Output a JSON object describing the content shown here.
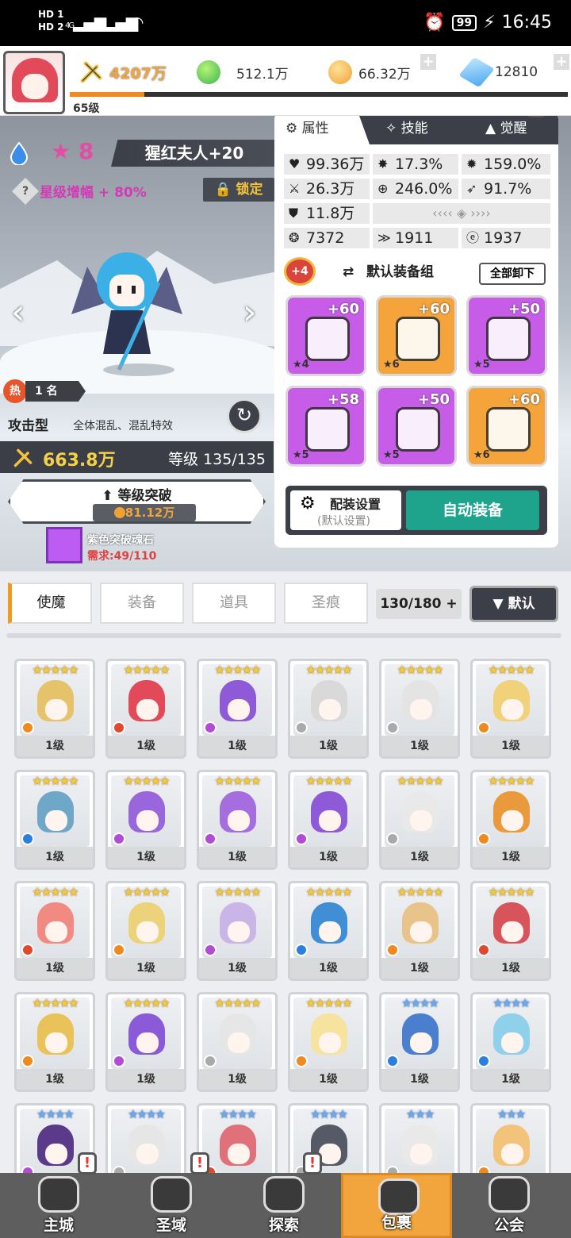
{
  "status_bar": {
    "hd1": "HD 1",
    "hd2": "HD 2",
    "net1": "4G",
    "net2": "4G",
    "battery": "99",
    "time": "16:45"
  },
  "topbar": {
    "level": "65级",
    "xp_fraction": 0.15,
    "power": "4207万",
    "gems_green": "512.1万",
    "gold": "66.32万",
    "crystals": "12810"
  },
  "hero": {
    "star_count": "8",
    "name": "猩红夫人+20",
    "star_boost": "星级增幅 + 80%",
    "lock_label": "锁定",
    "hot_label": "热",
    "rank": "1 名",
    "type": "攻击型",
    "skill_desc": "全体混乱、混乱特效",
    "power": "663.8万",
    "level": "等级 135/135",
    "break_label": "等级突破",
    "break_cost": "81.12万",
    "material_name": "紫色突破魂石",
    "material_req": "需求:49/110"
  },
  "attr_panel": {
    "tabs": [
      "属性",
      "技能",
      "觉醒"
    ],
    "stats": {
      "hp": "99.36万",
      "crit": "17.3%",
      "crit_dmg": "159.0%",
      "atk": "26.3万",
      "hit": "246.0%",
      "speed": "91.7%",
      "def": "11.8万",
      "s1": "7372",
      "s2": "1911",
      "s3": "1937"
    },
    "set_badge": "+4",
    "set_name": "默认装备组",
    "unload_all": "全部卸下",
    "equipment": [
      {
        "plus": "+60",
        "stars": "★4",
        "rarity": "purple"
      },
      {
        "plus": "+60",
        "stars": "★6",
        "rarity": "orange"
      },
      {
        "plus": "+50",
        "stars": "★5",
        "rarity": "purple"
      },
      {
        "plus": "+58",
        "stars": "★5",
        "rarity": "purple"
      },
      {
        "plus": "+50",
        "stars": "★5",
        "rarity": "purple"
      },
      {
        "plus": "+60",
        "stars": "★6",
        "rarity": "orange"
      }
    ],
    "config_label": "配装设置",
    "config_sub": "(默认设置)",
    "auto_equip": "自动装备"
  },
  "inventory": {
    "tabs": [
      "使魔",
      "装备",
      "道具",
      "圣痕"
    ],
    "count": "130/180",
    "sort_label": "▼ 默认"
  },
  "heroes": [
    {
      "stars": "★★★★★",
      "tier": "gold",
      "lv": "1级",
      "hair": "#e6c36a",
      "el": "#f08a1e"
    },
    {
      "stars": "★★★★★",
      "tier": "gold",
      "lv": "1级",
      "hair": "#e24a5a",
      "el": "#e0492b"
    },
    {
      "stars": "★★★★★",
      "tier": "gold",
      "lv": "1级",
      "hair": "#8e5ad8",
      "el": "#b24bd6"
    },
    {
      "stars": "★★★★★",
      "tier": "gold",
      "lv": "1级",
      "hair": "#d9d9d9",
      "el": "#aaaaaa"
    },
    {
      "stars": "★★★★★",
      "tier": "gold",
      "lv": "1级",
      "hair": "#e4e4e4",
      "el": "#aaaaaa"
    },
    {
      "stars": "★★★★★",
      "tier": "gold",
      "lv": "1级",
      "hair": "#f1d27a",
      "el": "#f08a1e"
    },
    {
      "stars": "★★★★★",
      "tier": "gold",
      "lv": "1级",
      "hair": "#6fa7c9",
      "el": "#2a7fe0"
    },
    {
      "stars": "★★★★★",
      "tier": "gold",
      "lv": "1级",
      "hair": "#9a66dc",
      "el": "#b24bd6"
    },
    {
      "stars": "★★★★★",
      "tier": "gold",
      "lv": "1级",
      "hair": "#a66ddf",
      "el": "#b24bd6"
    },
    {
      "stars": "★★★★★",
      "tier": "gold",
      "lv": "1级",
      "hair": "#8e5ad8",
      "el": "#b24bd6"
    },
    {
      "stars": "★★★★★",
      "tier": "gold",
      "lv": "1级",
      "hair": "#e9e9e9",
      "el": "#aaaaaa"
    },
    {
      "stars": "★★★★★",
      "tier": "gold",
      "lv": "1级",
      "hair": "#e99a3d",
      "el": "#f08a1e"
    },
    {
      "stars": "★★★★★",
      "tier": "gold",
      "lv": "1级",
      "hair": "#f08a82",
      "el": "#e0492b"
    },
    {
      "stars": "★★★★★",
      "tier": "gold",
      "lv": "1级",
      "hair": "#ecd27a",
      "el": "#f08a1e"
    },
    {
      "stars": "★★★★★",
      "tier": "gold",
      "lv": "1级",
      "hair": "#c9b6e6",
      "el": "#b24bd6"
    },
    {
      "stars": "★★★★★",
      "tier": "gold",
      "lv": "1级",
      "hair": "#3f8ed6",
      "el": "#2a7fe0"
    },
    {
      "stars": "★★★★★",
      "tier": "gold",
      "lv": "1级",
      "hair": "#e8c48a",
      "el": "#f08a1e"
    },
    {
      "stars": "★★★★★",
      "tier": "gold",
      "lv": "1级",
      "hair": "#d6545a",
      "el": "#e0492b"
    },
    {
      "stars": "★★★★★",
      "tier": "gold",
      "lv": "1级",
      "hair": "#e9c25a",
      "el": "#f08a1e"
    },
    {
      "stars": "★★★★★",
      "tier": "gold",
      "lv": "1级",
      "hair": "#8a5ad8",
      "el": "#b24bd6"
    },
    {
      "stars": "★★★★★",
      "tier": "gold",
      "lv": "1级",
      "hair": "#e6e6e6",
      "el": "#aaaaaa"
    },
    {
      "stars": "★★★★★",
      "tier": "gold",
      "lv": "1级",
      "hair": "#f6e3a0",
      "el": "#f08a1e"
    },
    {
      "stars": "★★★★",
      "tier": "blue",
      "lv": "1级",
      "hair": "#4a7fd0",
      "el": "#2a7fe0"
    },
    {
      "stars": "★★★★",
      "tier": "blue",
      "lv": "1级",
      "hair": "#8fd0ea",
      "el": "#2a7fe0"
    },
    {
      "stars": "★★★★",
      "tier": "blue",
      "lv": "",
      "hair": "#5c3a8a",
      "el": "#b24bd6"
    },
    {
      "stars": "★★★★",
      "tier": "blue",
      "lv": "",
      "hair": "#e6e6e6",
      "el": "#aaaaaa"
    },
    {
      "stars": "★★★★",
      "tier": "blue",
      "lv": "",
      "hair": "#e0707a",
      "el": "#e0492b"
    },
    {
      "stars": "★★★★",
      "tier": "blue",
      "lv": "",
      "hair": "#555a66",
      "el": "#aaaaaa"
    },
    {
      "stars": "★★★",
      "tier": "blue",
      "lv": "",
      "hair": "#e9e9e9",
      "el": "#aaaaaa"
    },
    {
      "stars": "★★★",
      "tier": "blue",
      "lv": "",
      "hair": "#f2c37a",
      "el": "#f08a1e"
    }
  ],
  "nav": [
    {
      "label": "主城",
      "alert": "!"
    },
    {
      "label": "圣域",
      "alert": "!"
    },
    {
      "label": "探索",
      "alert": "!"
    },
    {
      "label": "包裹",
      "alert": ""
    },
    {
      "label": "公会",
      "alert": ""
    }
  ]
}
